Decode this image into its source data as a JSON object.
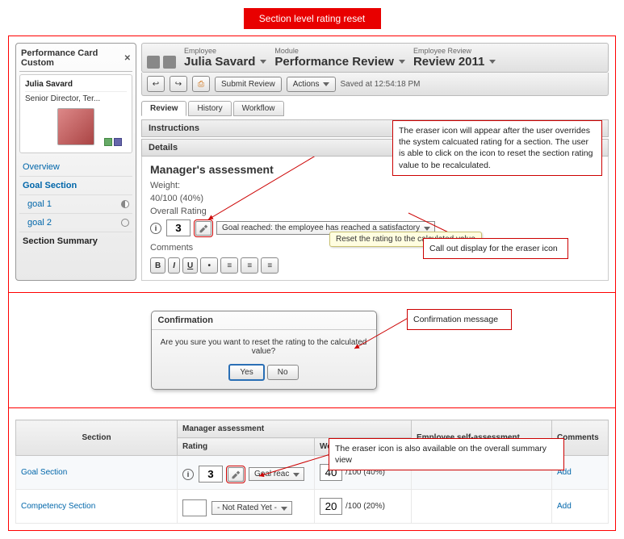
{
  "banner": "Section level rating reset",
  "perf_card": {
    "title": "Performance Card Custom",
    "close_glyph": "✕",
    "employee_name": "Julia Savard",
    "employee_title": "Senior Director, Ter..."
  },
  "sidenav": {
    "overview": "Overview",
    "goal_section": "Goal Section",
    "goal1": "goal 1",
    "goal2": "goal 2",
    "section_summary": "Section Summary"
  },
  "context": {
    "employee_label": "Employee",
    "employee_value": "Julia Savard",
    "module_label": "Module",
    "module_value": "Performance Review",
    "review_label": "Employee Review",
    "review_value": "Review 2011"
  },
  "toolbar": {
    "submit": "Submit Review",
    "actions": "Actions",
    "saved_at": "Saved at 12:54:18 PM"
  },
  "tabs": {
    "review": "Review",
    "history": "History",
    "workflow": "Workflow"
  },
  "sections": {
    "instructions": "Instructions",
    "details": "Details"
  },
  "assessment": {
    "heading": "Manager's assessment",
    "weight_label": "Weight:",
    "weight_value": "40/100 (40%)",
    "overall_label": "Overall Rating",
    "rating_value": "3",
    "rating_text": "Goal reached: the employee has reached a satisfactory",
    "comments_label": "Comments",
    "rte": {
      "b": "B",
      "i": "I",
      "u": "U"
    },
    "tooltip": "Reset the rating to the calculated value"
  },
  "annotations": {
    "eraser_desc": "The eraser icon will appear after the user overrides the system calcuated rating for a section. The user is able to click on the icon to reset the section rating value to be recalculated.",
    "callout_label": "Call out display for the eraser icon",
    "confirm_label": "Confirmation message",
    "summary_label": "The eraser icon is also available on the overall summary view"
  },
  "dialog": {
    "title": "Confirmation",
    "body": "Are you sure you want to reset the rating to the calculated value?",
    "yes": "Yes",
    "no": "No"
  },
  "summary": {
    "cols": {
      "section": "Section",
      "manager": "Manager assessment",
      "rating": "Rating",
      "weight": "Weight",
      "self": "Employee self-assessment",
      "comments": "Comments"
    },
    "rows": [
      {
        "section": "Goal Section",
        "rating_value": "3",
        "rating_text": "Goal reac",
        "weight_input": "40",
        "weight_display": "/100 (40%)",
        "add": "Add"
      },
      {
        "section": "Competency Section",
        "rating_value": "",
        "rating_text": "- Not Rated Yet -",
        "weight_input": "20",
        "weight_display": "/100 (20%)",
        "add": "Add"
      }
    ]
  }
}
